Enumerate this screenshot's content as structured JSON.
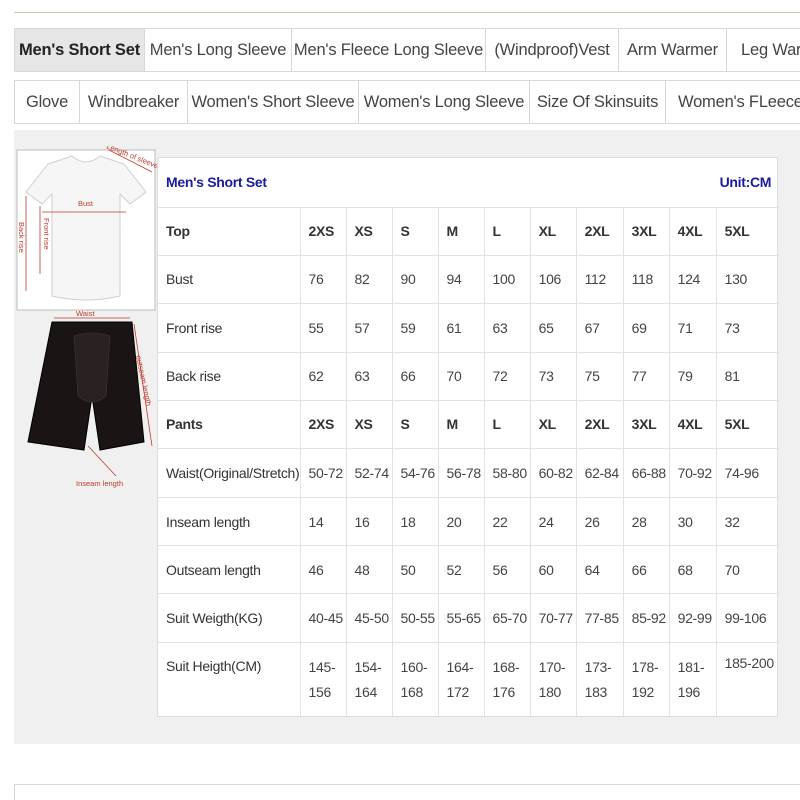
{
  "tabs_row1": [
    "Men's Short Set",
    "Men's Long Sleeve",
    "Men's Fleece Long Sleeve",
    "(Windproof)Vest",
    "Arm Warmer",
    "Leg Warm"
  ],
  "tabs_row2": [
    "Glove",
    "Windbreaker",
    "Women's Short Sleeve",
    "Women's Long Sleeve",
    "Size Of Skinsuits",
    "Women's FLeece L"
  ],
  "active_tab": "Men's Short Set",
  "diagram": {
    "length_of_sleeve": "Length of sleeve",
    "bust": "Bust",
    "front_rise": "Front rise",
    "back_rise": "Back rise",
    "waist": "Waist",
    "outseam_length": "outseam length",
    "inseam_length": "Inseam length"
  },
  "table": {
    "title": "Men's Short Set",
    "unit": "Unit:CM",
    "rows": [
      {
        "label": "Top",
        "header": true,
        "cells": [
          "2XS",
          "XS",
          "S",
          "M",
          "L",
          "XL",
          "2XL",
          "3XL",
          "4XL",
          "5XL"
        ]
      },
      {
        "label": "Bust",
        "cells": [
          "76",
          "82",
          "90",
          "94",
          "100",
          "106",
          "112",
          "118",
          "124",
          "130"
        ]
      },
      {
        "label": "Front rise",
        "cells": [
          "55",
          "57",
          "59",
          "61",
          "63",
          "65",
          "67",
          "69",
          "71",
          "73"
        ]
      },
      {
        "label": "Back rise",
        "cells": [
          "62",
          "63",
          "66",
          "70",
          "72",
          "73",
          "75",
          "77",
          "79",
          "81"
        ]
      },
      {
        "label": "Pants",
        "header": true,
        "cells": [
          "2XS",
          "XS",
          "S",
          "M",
          "L",
          "XL",
          "2XL",
          "3XL",
          "4XL",
          "5XL"
        ]
      },
      {
        "label": "Waist(Original/Stretch)",
        "cells": [
          "50-72",
          "52-74",
          "54-76",
          "56-78",
          "58-80",
          "60-82",
          "62-84",
          "66-88",
          "70-92",
          "74-96"
        ]
      },
      {
        "label": "Inseam length",
        "cells": [
          "14",
          "16",
          "18",
          "20",
          "22",
          "24",
          "26",
          "28",
          "30",
          "32"
        ]
      },
      {
        "label": "Outseam length",
        "cells": [
          "46",
          "48",
          "50",
          "52",
          "56",
          "60",
          "64",
          "66",
          "68",
          "70"
        ]
      },
      {
        "label": "Suit Weigth(KG)",
        "cells": [
          "40-45",
          "45-50",
          "50-55",
          "55-65",
          "65-70",
          "70-77",
          "77-85",
          "85-92",
          "92-99",
          "99-106"
        ]
      },
      {
        "label": "Suit Heigth(CM)",
        "cells": [
          "145-156",
          "154-164",
          "160-168",
          "164-172",
          "168-176",
          "170-180",
          "173-183",
          "178-192",
          "181-196",
          "185-200"
        ]
      }
    ]
  },
  "colors": {
    "title_blue": "#1a1aa0",
    "diagram_red": "#c0392b",
    "panel_gray": "#f0f0f0"
  }
}
